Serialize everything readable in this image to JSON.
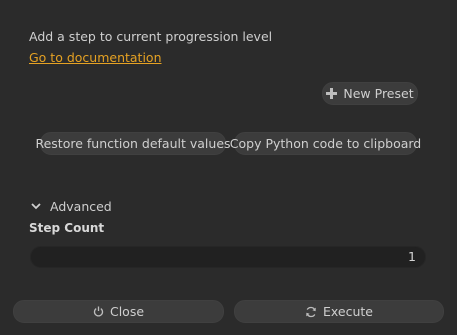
{
  "header": {
    "description": "Add a step to current progression level",
    "doc_link": "Go to documentation"
  },
  "toolbar": {
    "new_preset_label": "New Preset",
    "restore_label": "Restore function default values",
    "copy_label": "Copy Python code to clipboard"
  },
  "advanced": {
    "section_label": "Advanced",
    "step_count_label": "Step Count",
    "step_count_value": "1"
  },
  "footer": {
    "close_label": "Close",
    "execute_label": "Execute"
  },
  "icons": {
    "new_preset": "plus-icon",
    "advanced_toggle": "chevron-down-icon",
    "close": "power-icon",
    "execute": "refresh-icon"
  },
  "colors": {
    "background": "#2b2b2b",
    "link": "#e6a223",
    "button": "#3c3c3c",
    "input": "#212121"
  }
}
